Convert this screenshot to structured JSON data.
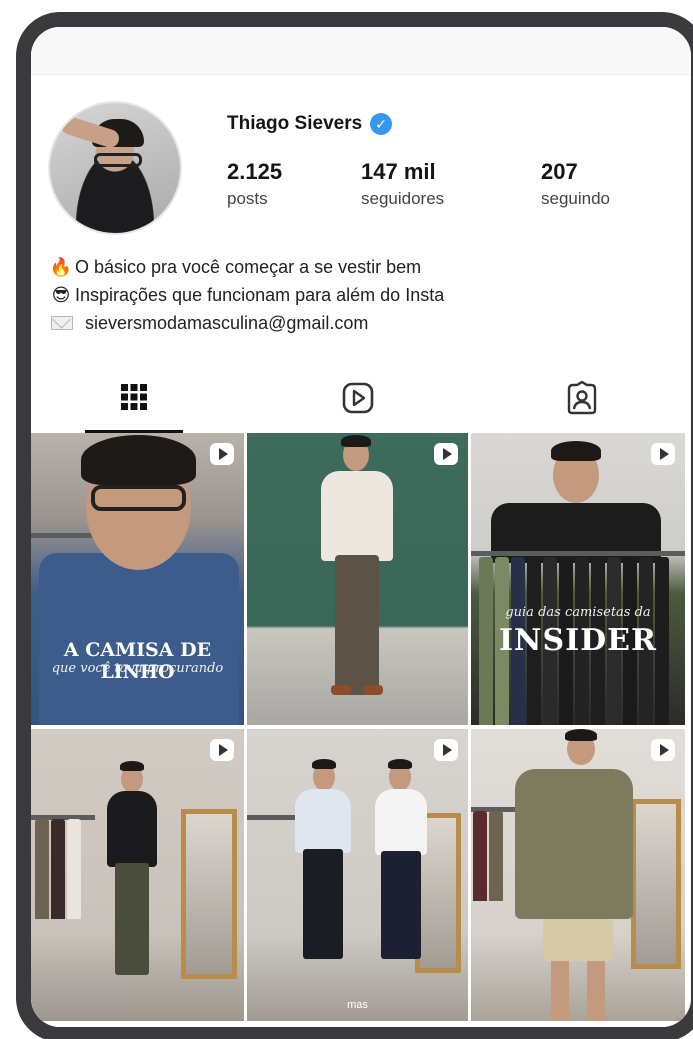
{
  "profile": {
    "name": "Thiago Sievers",
    "verified_mark": "✓",
    "stats": [
      {
        "value": "2.125",
        "label": "posts"
      },
      {
        "value": "147 mil",
        "label": "seguidores"
      },
      {
        "value": "207",
        "label": "seguindo"
      }
    ],
    "bio": [
      {
        "icon": "fire-emoji",
        "emoji": "🔥",
        "text": "O básico pra você começar a se vestir bem"
      },
      {
        "icon": "sunglasses-emoji",
        "emoji": "😎",
        "text": "Inspirações que funcionam para além do Insta"
      },
      {
        "icon": "envelope-icon",
        "emoji": "",
        "text": "sieversmodamasculina@gmail.com"
      }
    ]
  },
  "tabs": [
    {
      "name": "grid-tab",
      "icon": "grid-icon",
      "active": true
    },
    {
      "name": "reels-tab",
      "icon": "reels-icon",
      "active": false
    },
    {
      "name": "tagged-tab",
      "icon": "tagged-icon",
      "active": false
    }
  ],
  "posts": [
    {
      "overlay_title": "A CAMISA DE LINHO",
      "overlay_subtitle": "que você tava procurando",
      "reel": true
    },
    {
      "reel": true
    },
    {
      "overlay_subtitle": "guia das camisetas da",
      "overlay_title": "INSIDER",
      "reel": true
    },
    {
      "reel": true
    },
    {
      "caption": "mas",
      "reel": true
    },
    {
      "reel": true
    }
  ],
  "colors": {
    "verified": "#3897f0",
    "frame": "#3a3a3d",
    "text": "#151515"
  }
}
